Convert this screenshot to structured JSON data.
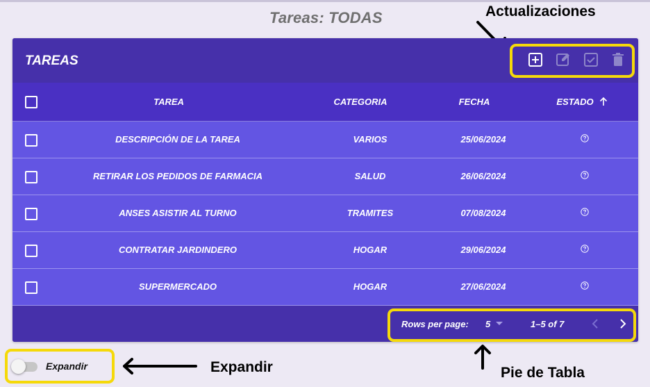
{
  "page": {
    "title": "Tareas: TODAS"
  },
  "annotations": {
    "updates": "Actualizaciones",
    "expand": "Expandir",
    "footer": "Pie de Tabla"
  },
  "toolbar": {
    "title": "TAREAS",
    "icons": [
      "add-box-icon",
      "edit-icon",
      "check-box-icon",
      "delete-icon"
    ]
  },
  "table": {
    "headers": {
      "tarea": "TAREA",
      "categoria": "CATEGORIA",
      "fecha": "FECHA",
      "estado": "ESTADO",
      "sort_icon": "arrow-up-icon"
    },
    "rows": [
      {
        "tarea": "DESCRIPCIÓN DE LA TAREA",
        "categoria": "VARIOS",
        "fecha": "25/06/2024"
      },
      {
        "tarea": "RETIRAR LOS PEDIDOS DE FARMACIA",
        "categoria": "SALUD",
        "fecha": "26/06/2024"
      },
      {
        "tarea": "ANSES ASISTIR AL TURNO",
        "categoria": "TRAMITES",
        "fecha": "07/08/2024"
      },
      {
        "tarea": "CONTRATAR JARDINDERO",
        "categoria": "HOGAR",
        "fecha": "29/06/2024"
      },
      {
        "tarea": "SUPERMERCADO",
        "categoria": "HOGAR",
        "fecha": "27/06/2024"
      }
    ],
    "status_icon": "help-circle-icon"
  },
  "footer": {
    "rows_label": "Rows per page:",
    "rows_value": "5",
    "range": "1–5 of 7"
  },
  "toggle": {
    "label": "Expandir",
    "checked": false
  },
  "colors": {
    "accent": "#4630aa",
    "row": "#6355e3",
    "highlight": "#f5d90a"
  }
}
